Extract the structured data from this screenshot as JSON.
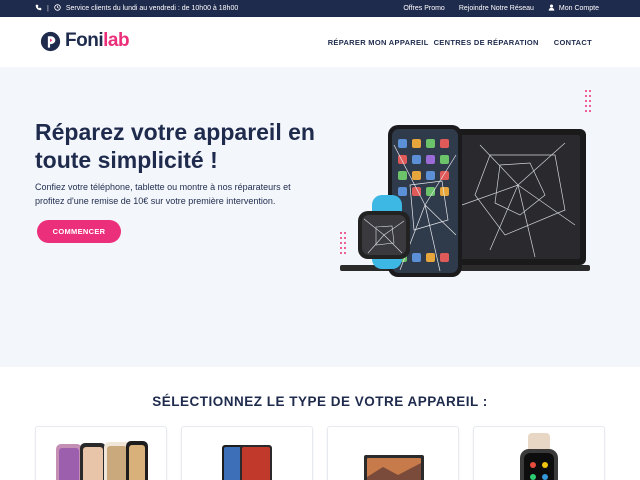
{
  "topbar": {
    "service_hours": "Service clients du lundi au vendredi : de 10h00 à 18h00",
    "links": [
      "Offres Promo",
      "Rejoindre Notre Réseau",
      "Mon Compte"
    ],
    "background": "#1f2b4d"
  },
  "header": {
    "logo_part1": "Foni",
    "logo_part2": "lab",
    "nav": [
      "RÉPARER MON APPAREIL",
      "CENTRES DE RÉPARATION",
      "CONTACT"
    ]
  },
  "hero": {
    "title": "Réparez votre appareil en toute simplicité !",
    "description": "Confiez votre téléphone, tablette ou montre à nos réparateurs et profitez d'une remise de 10€ sur votre première intervention.",
    "cta": "COMMENCER"
  },
  "devices_section": {
    "title": "SÉLECTIONNEZ LE TYPE DE VOTRE APPAREIL :"
  },
  "icons": [
    "phone-icon",
    "clock-icon",
    "user-icon"
  ],
  "colors": {
    "accent": "#ec2f7b",
    "navy": "#1f2b4d",
    "hero_bg": "#f3f6fb"
  }
}
